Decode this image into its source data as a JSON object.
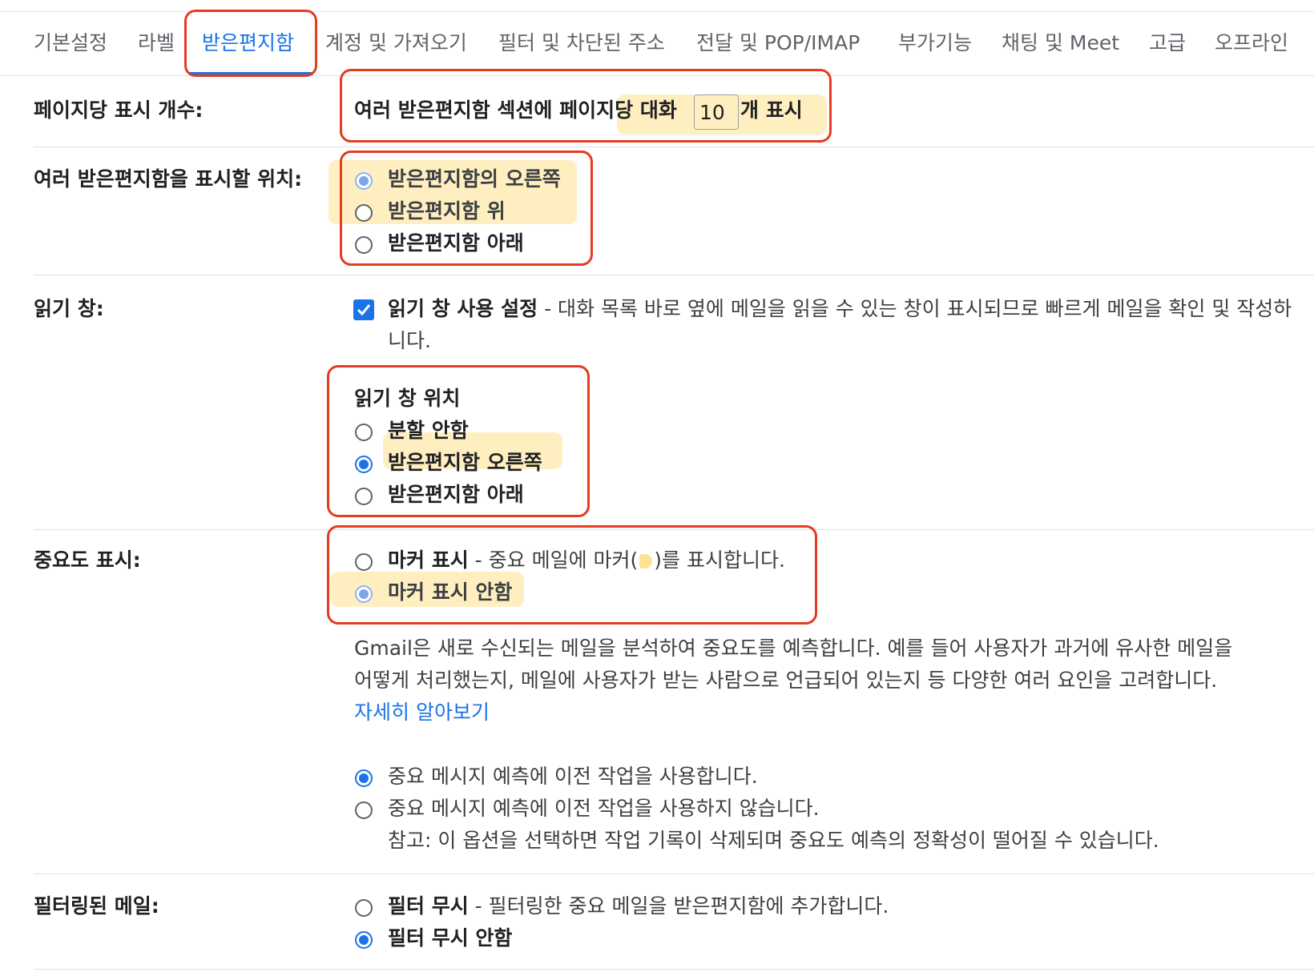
{
  "tabs": [
    "기본설정",
    "라벨",
    "받은편지함",
    "계정 및 가져오기",
    "필터 및 차단된 주소",
    "전달 및 POP/IMAP",
    "부가기능",
    "채팅 및 Meet",
    "고급",
    "오프라인"
  ],
  "active_tab": "받은편지함",
  "page_size": {
    "label": "페이지당 표시 개수:",
    "text_before": "여러 받은편지함 섹션에 페이지당 대화",
    "value": "10",
    "text_after": "개 표시"
  },
  "position": {
    "label": "여러 받은편지함을 표시할 위치:",
    "options": [
      "받은편지함의 오른쪽",
      "받은편지함 위",
      "받은편지함 아래"
    ],
    "selected": 0
  },
  "reading_pane": {
    "label": "읽기 창:",
    "enable_title": "읽기 창 사용 설정",
    "enable_desc": " - 대화 목록 바로 옆에 메일을 읽을 수 있는 창이 표시되므로 빠르게 메일을 확인 및 작성하",
    "enable_desc_cont": "니다.",
    "enabled": true,
    "position_title": "읽기 창 위치",
    "options": [
      "분할 안함",
      "받은편지함 오른쪽",
      "받은편지함 아래"
    ],
    "selected": 1
  },
  "importance": {
    "label": "중요도 표시:",
    "marker_title": "마커 표시",
    "marker_desc_before": " - 중요 메일에 마커(",
    "marker_desc_after": ")를 표시합니다.",
    "no_marker": "마커 표시 안함",
    "selected": 1,
    "info_line1": "Gmail은 새로 수신되는 메일을 분석하여 중요도를 예측합니다. 예를 들어 사용자가 과거에 유사한 메일을",
    "info_line2": "어떻게 처리했는지, 메일에 사용자가 받는 사람으로 언급되어 있는지 등 다양한 여러 요인을 고려합니다.",
    "learn_more": "자세히 알아보기",
    "use_past": "중요 메시지 예측에 이전 작업을 사용합니다.",
    "no_use_past": "중요 메시지 예측에 이전 작업을 사용하지 않습니다.",
    "note": "참고: 이 옵션을 선택하면 작업 기록이 삭제되며 중요도 예측의 정확성이 떨어질 수 있습니다.",
    "past_selected": 0
  },
  "filtered": {
    "label": "필터링된 메일:",
    "ignore_title": "필터 무시",
    "ignore_desc": " - 필터링한 중요 메일을 받은편지함에 추가합니다.",
    "no_ignore": "필터 무시 안함",
    "selected": 1
  },
  "colors": {
    "accent": "#1a73e8",
    "annotation": "#e53b1f",
    "highlight": "#ffe28c",
    "marker": "#fde293"
  }
}
